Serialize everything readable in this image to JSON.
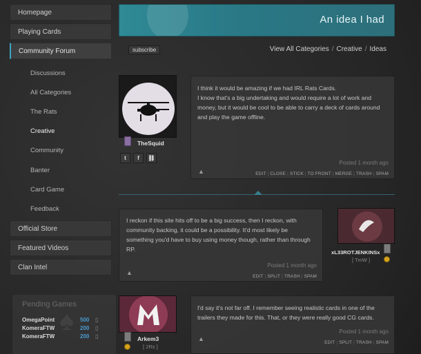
{
  "sidebar": {
    "items": [
      {
        "label": "Homepage"
      },
      {
        "label": "Playing Cards"
      },
      {
        "label": "Community Forum"
      }
    ],
    "sub_items": [
      {
        "label": "Discussions"
      },
      {
        "label": "All Categories"
      },
      {
        "label": "The Rats"
      },
      {
        "label": "Creative"
      },
      {
        "label": "Community"
      },
      {
        "label": "Banter"
      },
      {
        "label": "Card Game"
      },
      {
        "label": "Feedback"
      }
    ],
    "bottom_items": [
      {
        "label": "Official Store"
      },
      {
        "label": "Featured Videos"
      },
      {
        "label": "Clan Intel"
      }
    ]
  },
  "pending": {
    "title": "Pending Games",
    "rows": [
      {
        "name": "OmegaPoint",
        "points": "500"
      },
      {
        "name": "KomeraFTW",
        "points": "200"
      },
      {
        "name": "KomeraFTW",
        "points": "200"
      }
    ]
  },
  "banner": {
    "title": "An idea I had"
  },
  "subbar": {
    "subscribe": "subscribe",
    "crumbs": [
      "View All Categories",
      "Creative",
      "Ideas"
    ]
  },
  "posts": [
    {
      "username": "TheSquid",
      "text": "I think it would be amazing if we had IRL Rats Cards.\nI know that's a big undertaking and would require a lot of work and money, but it would be cool to be able to carry a deck of cards around and play the game offline.",
      "posted": "Posted 1 month ago",
      "actions": [
        "EDIT",
        "CLOSE",
        "STICK",
        "TO FRONT",
        "MERGE",
        "TRASH",
        "SPAM"
      ],
      "share": [
        "t",
        "f",
        "⛓"
      ]
    },
    {
      "username": "xL33ROTJENKINSx",
      "tag": "[ TmW ]",
      "text": "I reckon if this site hits off to be a big success, then I reckon, with community backing, it could be a possibility. It'd most likely be something you'd have to buy using money though, rather than through RP.",
      "posted": "Posted 1 month ago",
      "actions": [
        "EDIT",
        "SPLIT",
        "TRASH",
        "SPAM"
      ]
    },
    {
      "username": "Arkem3",
      "tag": "[ 2Rs ]",
      "text": "I'd say it's not far off. I remember seeing realistic cards in one of the trailers they made for this. That, or they were really good CG cards.",
      "posted": "Posted 1 month ago",
      "actions": [
        "EDIT",
        "SPLIT",
        "TRASH",
        "SPAM"
      ]
    }
  ],
  "colors": {
    "accent": "#3aa7c4",
    "banner": "#2f8a96",
    "points": "#4a9ad0",
    "coin": "#d6a21b"
  }
}
